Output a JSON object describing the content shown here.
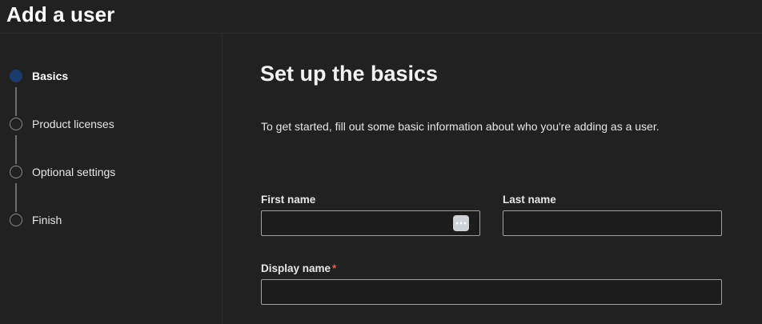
{
  "header": {
    "title": "Add a user"
  },
  "steps": [
    {
      "label": "Basics",
      "active": true
    },
    {
      "label": "Product licenses",
      "active": false
    },
    {
      "label": "Optional settings",
      "active": false
    },
    {
      "label": "Finish",
      "active": false
    }
  ],
  "main": {
    "title": "Set up the basics",
    "intro": "To get started, fill out some basic information about who you're adding as a user.",
    "first_name": {
      "label": "First name",
      "value": ""
    },
    "last_name": {
      "label": "Last name",
      "value": ""
    },
    "display_name": {
      "label": "Display name",
      "required_marker": "*",
      "value": ""
    }
  },
  "colors": {
    "background": "#212121",
    "active_step": "#1b3a6b",
    "required": "#e05a4f"
  },
  "icons": {
    "autofill": "more-horizontal-icon"
  }
}
